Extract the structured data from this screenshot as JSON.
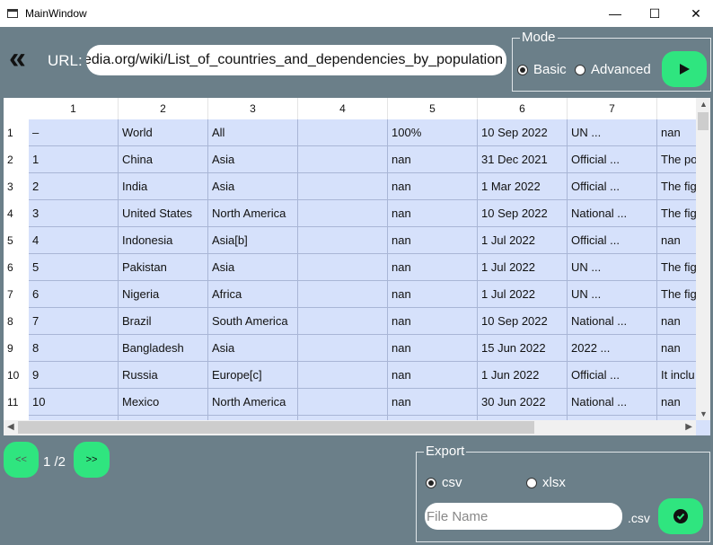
{
  "window": {
    "title": "MainWindow",
    "minimize": "—",
    "maximize": "☐",
    "close": "✕"
  },
  "toolbar": {
    "back_icon": "«",
    "url_label": "URL:",
    "url_value": "https://en.wikipedia.org/wiki/List_of_countries_and_dependencies_by_population"
  },
  "mode": {
    "legend": "Mode",
    "options": [
      "Basic",
      "Advanced"
    ],
    "selected": "Basic",
    "run_icon": "play-icon"
  },
  "table": {
    "columns": [
      "1",
      "2",
      "3",
      "4",
      "5",
      "6",
      "7",
      ""
    ],
    "rows": [
      [
        "1",
        [
          "–",
          "World",
          "All",
          "",
          "100%",
          "10 Sep 2022",
          "UN ...",
          "nan"
        ]
      ],
      [
        "2",
        [
          "1",
          "China",
          "Asia",
          "",
          "nan",
          "31 Dec 2021",
          "Official ...",
          "The po"
        ]
      ],
      [
        "3",
        [
          "2",
          "India",
          "Asia",
          "",
          "nan",
          "1 Mar 2022",
          "Official ...",
          "The fig"
        ]
      ],
      [
        "4",
        [
          "3",
          "United States",
          "North America",
          "",
          "nan",
          "10 Sep 2022",
          "National ...",
          "The fig"
        ]
      ],
      [
        "5",
        [
          "4",
          "Indonesia",
          "Asia[b]",
          "",
          "nan",
          "1 Jul 2022",
          "Official ...",
          "nan"
        ]
      ],
      [
        "6",
        [
          "5",
          "Pakistan",
          "Asia",
          "",
          "nan",
          "1 Jul 2022",
          "UN ...",
          "The fig"
        ]
      ],
      [
        "7",
        [
          "6",
          "Nigeria",
          "Africa",
          "",
          "nan",
          "1 Jul 2022",
          "UN ...",
          "The fig"
        ]
      ],
      [
        "8",
        [
          "7",
          "Brazil",
          "South America",
          "",
          "nan",
          "10 Sep 2022",
          "National ...",
          "nan"
        ]
      ],
      [
        "9",
        [
          "8",
          "Bangladesh",
          "Asia",
          "",
          "nan",
          "15 Jun 2022",
          "2022 ...",
          "nan"
        ]
      ],
      [
        "10",
        [
          "9",
          "Russia",
          "Europe[c]",
          "",
          "nan",
          "1 Jun 2022",
          "Official ...",
          "It inclu"
        ]
      ],
      [
        "11",
        [
          "10",
          "Mexico",
          "North America",
          "",
          "nan",
          "30 Jun 2022",
          "National ...",
          "nan"
        ]
      ],
      [
        "",
        [
          "",
          "",
          "",
          "",
          "",
          "",
          "",
          ""
        ]
      ]
    ]
  },
  "pagination": {
    "prev": "<<",
    "next": ">>",
    "label": "1 /2"
  },
  "export": {
    "legend": "Export",
    "options": [
      "csv",
      "xlsx"
    ],
    "selected": "csv",
    "filename_placeholder": "File Name",
    "extension": ".csv",
    "confirm_icon": "check-circle-icon"
  },
  "colors": {
    "background": "#6b7f89",
    "accent": "#2fe57f",
    "cell": "#d6e1fb"
  }
}
